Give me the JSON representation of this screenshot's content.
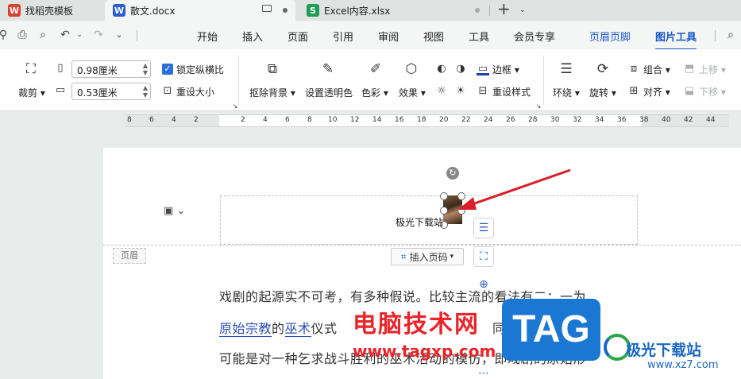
{
  "tabs": [
    {
      "label": "找稻壳模板",
      "icon": "W"
    },
    {
      "label": "散文.docx",
      "icon": "W"
    },
    {
      "label": "Excel内容.xlsx",
      "icon": "S"
    }
  ],
  "menu": [
    "开始",
    "插入",
    "页面",
    "引用",
    "审阅",
    "视图",
    "工具",
    "会员专享",
    "页眉页脚",
    "图片工具"
  ],
  "ribbon": {
    "crop": "裁剪",
    "width_value": "0.98厘米",
    "height_value": "0.53厘米",
    "lock_ratio": "锁定纵横比",
    "reset_size": "重设大小",
    "remove_bg": "抠除背景",
    "set_transparent": "设置透明色",
    "color": "色彩",
    "effects": "效果",
    "border": "边框",
    "reset_style": "重设样式",
    "wrap": "环绕",
    "rotate": "旋转",
    "group": "组合",
    "align": "对齐",
    "bring_forward": "上移",
    "send_backward": "下移"
  },
  "ruler": [
    "8",
    "6",
    "4",
    "2",
    "2",
    "4",
    "6",
    "8",
    "10",
    "12",
    "14",
    "16",
    "18",
    "20",
    "22",
    "24",
    "26",
    "28",
    "30",
    "32",
    "34",
    "36",
    "38",
    "40",
    "42",
    "44"
  ],
  "document": {
    "header_text": "极光下载站",
    "header_label": "页眉",
    "insert_page_number": "插入页码",
    "line1": "戏剧的起源实不可考，有多种假说。比较主流的看法有二：一为",
    "line2_a": "原始宗教",
    "line2_b": "的",
    "line2_c": "巫术",
    "line2_d": "仪式",
    "line2_e": "同源，",
    "line3": "可能是对一种乞求战斗胜利的巫术活动的模仿，即戏剧的原始形"
  },
  "watermarks": {
    "site_name": "电脑技术网",
    "site_url": "www.tagxp.com",
    "tag": "TAG",
    "jg_name": "极光下载站",
    "jg_url": "www.xz7.com"
  },
  "colors": {
    "accent": "#1a56c8",
    "word_blue": "#2b5fce",
    "excel_green": "#1f9d55",
    "wps_red": "#d9412f"
  }
}
